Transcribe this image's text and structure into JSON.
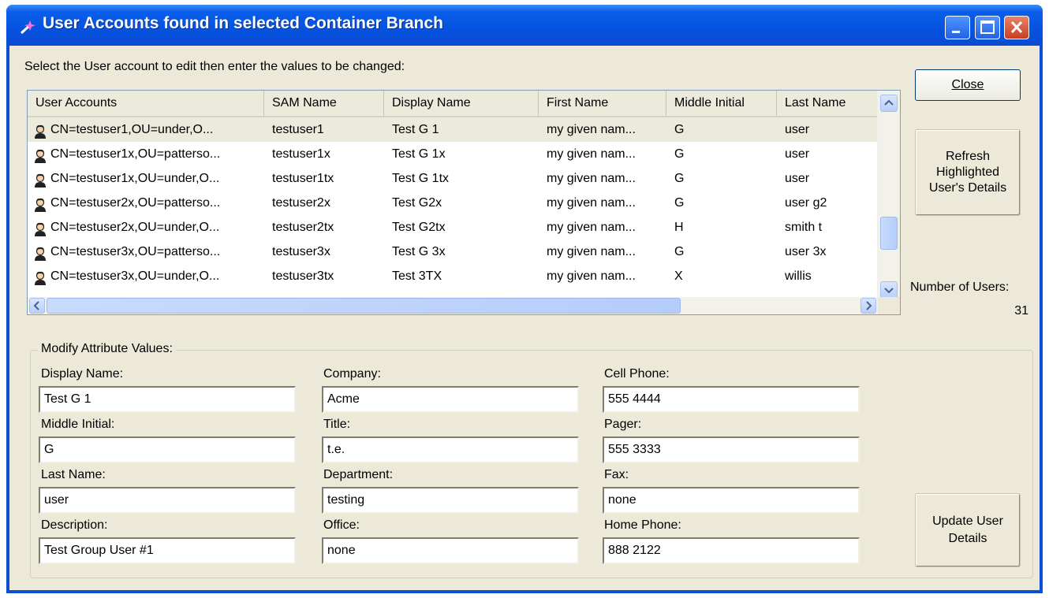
{
  "window": {
    "title": "User Accounts found in selected Container Branch",
    "title_icon": "wand-icon"
  },
  "instruction": "Select the User account to edit then enter the values to be changed:",
  "list": {
    "columns": [
      "User Accounts",
      "SAM Name",
      "Display Name",
      "First Name",
      "Middle Initial",
      "Last Name"
    ],
    "rows": [
      [
        "CN=testuser1,OU=under,O...",
        "testuser1",
        "Test G 1",
        "my given nam...",
        "G",
        "user"
      ],
      [
        "CN=testuser1x,OU=patterso...",
        "testuser1x",
        "Test G 1x",
        "my given nam...",
        "G",
        "user"
      ],
      [
        "CN=testuser1x,OU=under,O...",
        "testuser1tx",
        "Test G 1tx",
        "my given nam...",
        "G",
        "user"
      ],
      [
        "CN=testuser2x,OU=patterso...",
        "testuser2x",
        "Test G2x",
        "my given nam...",
        "G",
        "user g2"
      ],
      [
        "CN=testuser2x,OU=under,O...",
        "testuser2tx",
        "Test G2tx",
        "my given nam...",
        "H",
        "smith t"
      ],
      [
        "CN=testuser3x,OU=patterso...",
        "testuser3x",
        "Test G 3x",
        "my given nam...",
        "G",
        "user 3x"
      ],
      [
        "CN=testuser3x,OU=under,O...",
        "testuser3tx",
        "Test 3TX",
        "my given nam...",
        "X",
        "willis"
      ]
    ],
    "selected_index": 0,
    "row_icon": "user-icon"
  },
  "buttons": {
    "close": "Close",
    "refresh": "Refresh Highlighted User's Details",
    "update": "Update User Details"
  },
  "user_count": {
    "label": "Number of Users:",
    "value": "31"
  },
  "form": {
    "group_title": "Modify Attribute Values:",
    "fields": {
      "display_name": {
        "label": "Display Name:",
        "value": "Test G 1"
      },
      "middle_initial": {
        "label": "Middle Initial:",
        "value": "G"
      },
      "last_name": {
        "label": "Last Name:",
        "value": "user"
      },
      "description": {
        "label": "Description:",
        "value": "Test Group User #1"
      },
      "company": {
        "label": "Company:",
        "value": "Acme"
      },
      "title": {
        "label": "Title:",
        "value": "t.e."
      },
      "department": {
        "label": "Department:",
        "value": "testing"
      },
      "office": {
        "label": "Office:",
        "value": "none"
      },
      "cell_phone": {
        "label": "Cell Phone:",
        "value": "555 4444"
      },
      "pager": {
        "label": "Pager:",
        "value": "555 3333"
      },
      "fax": {
        "label": "Fax:",
        "value": "none"
      },
      "home_phone": {
        "label": "Home Phone:",
        "value": "888 2122"
      }
    }
  }
}
